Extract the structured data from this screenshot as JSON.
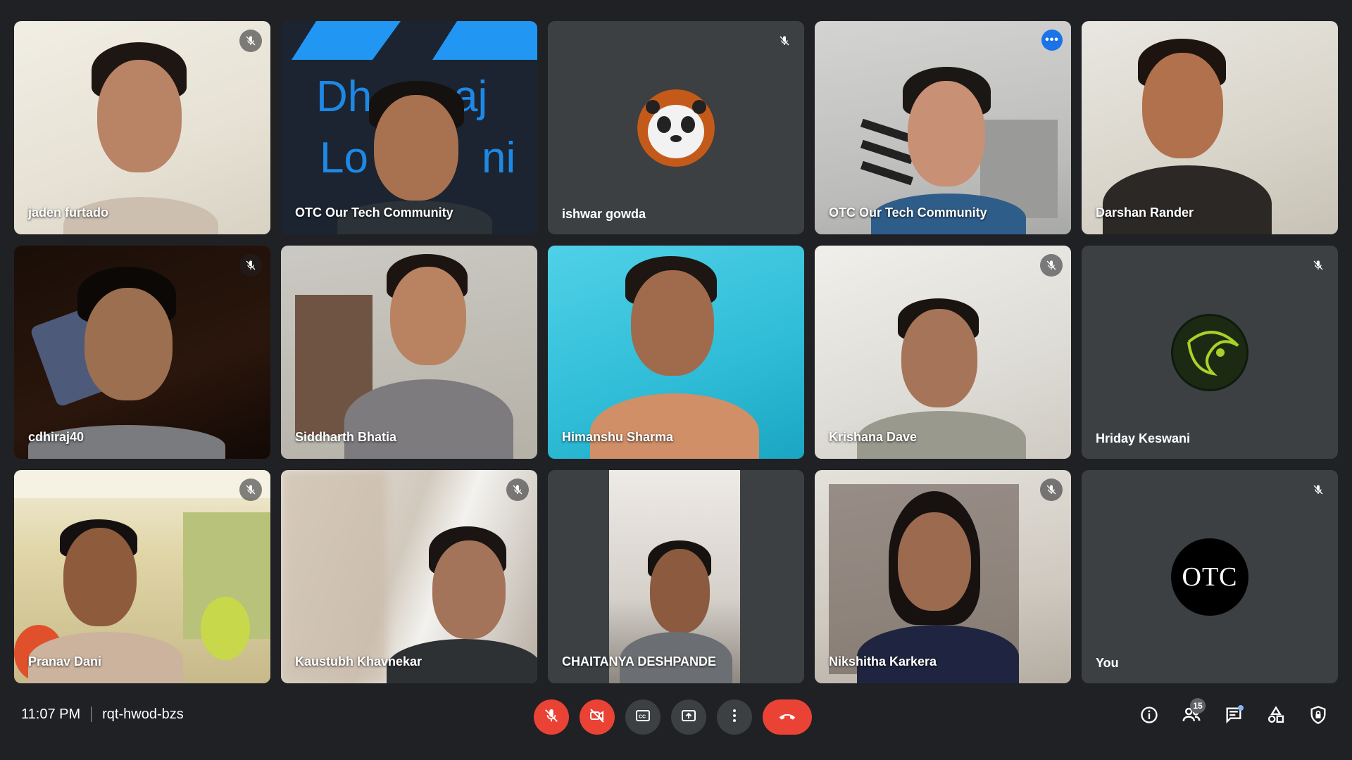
{
  "meeting": {
    "time": "11:07 PM",
    "code": "rqt-hwod-bzs"
  },
  "participant_count": "15",
  "participants": [
    {
      "name": "jaden furtado",
      "muted": true
    },
    {
      "name": "OTC Our Tech Community",
      "muted": false,
      "background_text": "Dhiraj Lalwani"
    },
    {
      "name": "ishwar gowda",
      "muted": true
    },
    {
      "name": "OTC Our Tech Community",
      "muted": false,
      "active": true
    },
    {
      "name": "Darshan Rander",
      "muted": false
    },
    {
      "name": "cdhiraj40",
      "muted": true
    },
    {
      "name": "Siddharth Bhatia",
      "muted": false
    },
    {
      "name": "Himanshu Sharma",
      "muted": false
    },
    {
      "name": "Krishana Dave",
      "muted": true
    },
    {
      "name": "Hriday Keswani",
      "muted": true
    },
    {
      "name": "Pranav Dani",
      "muted": true
    },
    {
      "name": "Kaustubh Khavnekar",
      "muted": true
    },
    {
      "name": "CHAITANYA DESHPANDE",
      "muted": false
    },
    {
      "name": "Nikshitha Karkera",
      "muted": true
    },
    {
      "name": "You",
      "muted": true,
      "avatar_text": "OTC"
    }
  ],
  "colors": {
    "background": "#202124",
    "tile": "#3c4043",
    "danger": "#ea4335",
    "accent": "#8ab4f8",
    "more_badge": "#1a73e8"
  },
  "controls": [
    "mic-off-icon",
    "camera-off-icon",
    "captions-icon",
    "present-icon",
    "more-vert-icon",
    "call-end-icon"
  ],
  "right_icons": [
    "info-icon",
    "people-icon",
    "chat-icon",
    "activities-icon",
    "host-controls-icon"
  ]
}
